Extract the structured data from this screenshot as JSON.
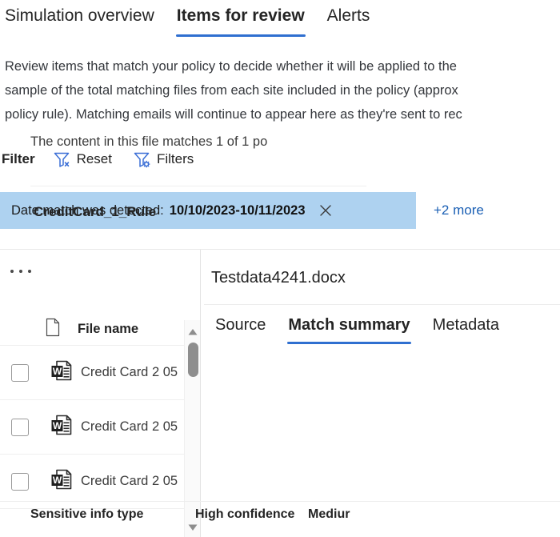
{
  "top_tabs": [
    {
      "label": "Simulation overview",
      "active": false
    },
    {
      "label": "Items for review",
      "active": true
    },
    {
      "label": "Alerts",
      "active": false
    }
  ],
  "description": {
    "line1": "Review items that match your policy to decide whether it will be applied to the",
    "line2": "sample of the total matching files from each site included in the policy (approx",
    "line3": "policy rule). Matching emails will continue to appear here as they're sent to rec"
  },
  "filter_bar": {
    "label": "Filter",
    "reset_label": "Reset",
    "reset_icon": "funnel-x-icon",
    "filters_label": "Filters",
    "filters_icon": "funnel-gear-icon"
  },
  "filter_chip": {
    "label": "Date match was detected:",
    "value": "10/10/2023-10/11/2023",
    "close_icon": "close-icon",
    "more_label": "+2 more"
  },
  "left_pane": {
    "overflow_icon": "ellipsis-icon",
    "column_icon": "document-icon",
    "column_header": "File name",
    "rows": [
      {
        "name": "Credit Card 2 05",
        "icon": "word-document-icon",
        "checked": false
      },
      {
        "name": "Credit Card 2 05",
        "icon": "word-document-icon",
        "checked": false
      },
      {
        "name": "Credit Card 2 05",
        "icon": "word-document-icon",
        "checked": false
      }
    ],
    "scrollbar": {
      "up_icon": "scroll-up-arrow-icon",
      "down_icon": "scroll-down-arrow-icon"
    }
  },
  "right_pane": {
    "title": "Testdata4241.docx",
    "tabs": [
      {
        "label": "Source",
        "active": false
      },
      {
        "label": "Match summary",
        "active": true
      },
      {
        "label": "Metadata",
        "active": false
      }
    ],
    "match_text": "The content in this file matches 1 of 1 po",
    "rule_name": "CreditCard_1_Rule",
    "table_headers": [
      "Sensitive info type",
      "High confidence",
      "Mediur"
    ]
  },
  "colors": {
    "accent": "#2f6fd0",
    "chip_background": "#aed2f0",
    "link": "#1a5fb4",
    "text": "#242424"
  }
}
